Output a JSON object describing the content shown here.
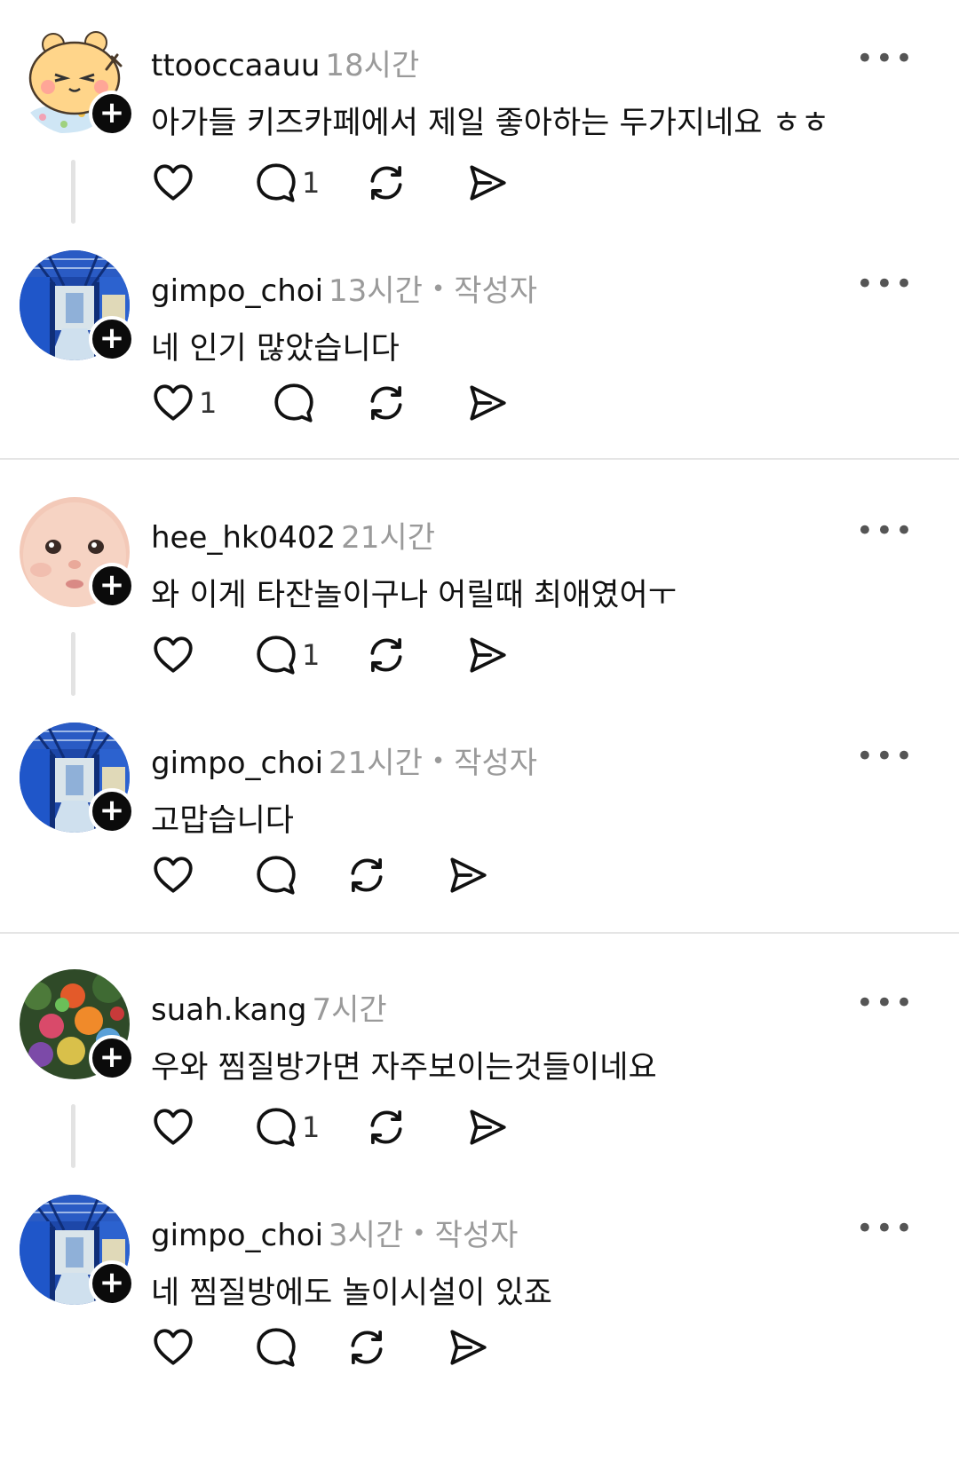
{
  "posts": [
    {
      "username": "ttooccaauu",
      "time": "18시간",
      "author_badge": "",
      "text": "아가들  키즈카페에서 제일 좋아하는 두가지네요 ㅎㅎ",
      "like_count": "",
      "reply_count": "1",
      "avatar": "bear-sticker-avatar"
    },
    {
      "username": "gimpo_choi",
      "time": "13시간",
      "author_badge": "작성자",
      "text": "네 인기 많았습니다",
      "like_count": "1",
      "reply_count": "",
      "avatar": "blue-corridor-avatar"
    },
    {
      "username": "hee_hk0402",
      "time": "21시간",
      "author_badge": "",
      "text": "와 이게 타잔놀이구나 어릴때 최애였어ㅜ",
      "like_count": "",
      "reply_count": "1",
      "avatar": "baby-face-avatar"
    },
    {
      "username": "gimpo_choi",
      "time": "21시간",
      "author_badge": "작성자",
      "text": "고맙습니다",
      "like_count": "",
      "reply_count": "",
      "avatar": "blue-corridor-avatar"
    },
    {
      "username": "suah.kang",
      "time": "7시간",
      "author_badge": "",
      "text": "우와 찜질방가면 자주보이는것들이네요",
      "like_count": "",
      "reply_count": "1",
      "avatar": "plush-toys-avatar"
    },
    {
      "username": "gimpo_choi",
      "time": "3시간",
      "author_badge": "작성자",
      "text": "네 찜질방에도 놀이시설이 있죠",
      "like_count": "",
      "reply_count": "",
      "avatar": "blue-corridor-avatar"
    }
  ],
  "icons": {
    "more": "more-horizontal-icon",
    "like": "heart-icon",
    "reply": "comment-icon",
    "repost": "repost-icon",
    "share": "send-icon",
    "follow": "plus-icon"
  },
  "separator_dot": "•",
  "more_glyph": "•••",
  "follow_glyph": "+"
}
